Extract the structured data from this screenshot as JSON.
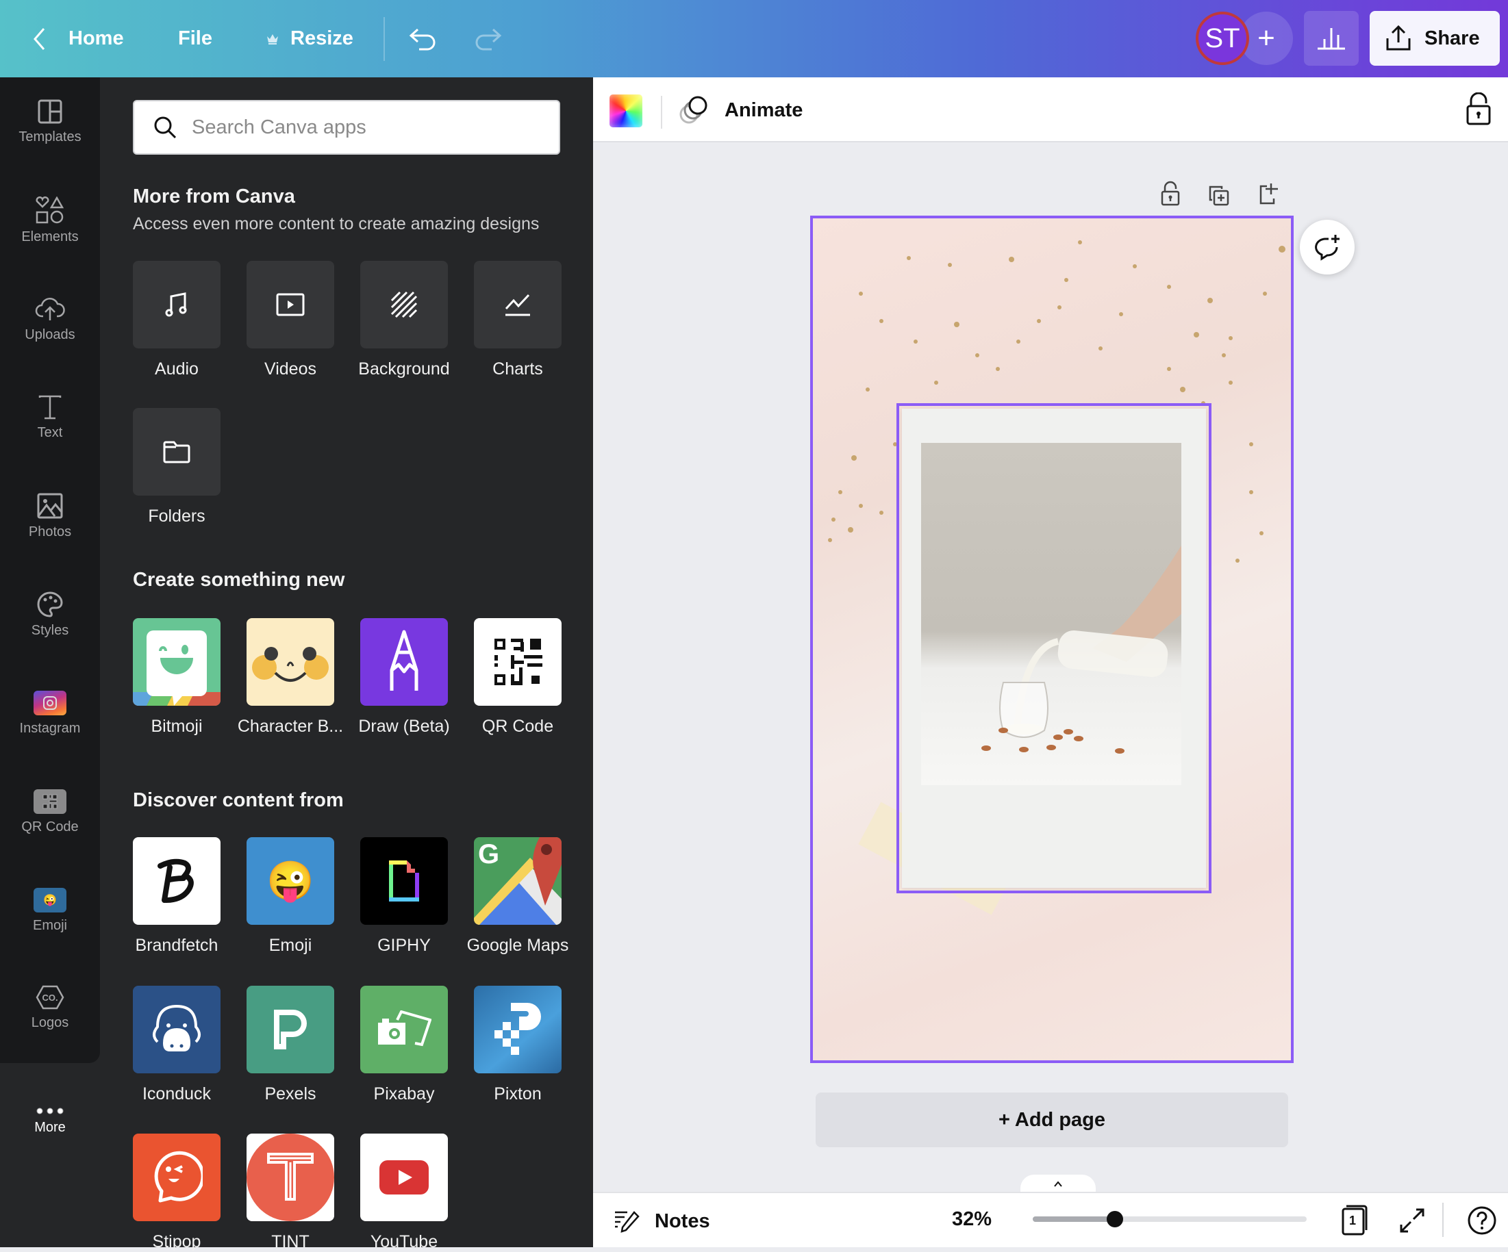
{
  "header": {
    "back_label": "Home",
    "file_label": "File",
    "resize_label": "Resize",
    "avatar_initials": "ST",
    "share_label": "Share",
    "gradient_colors": [
      "#56c1c9",
      "#4f6ad6",
      "#7339d9"
    ]
  },
  "rail": {
    "items": [
      {
        "label": "Templates",
        "icon": "templates-icon"
      },
      {
        "label": "Elements",
        "icon": "elements-icon"
      },
      {
        "label": "Uploads",
        "icon": "upload-cloud-icon"
      },
      {
        "label": "Text",
        "icon": "text-icon"
      },
      {
        "label": "Photos",
        "icon": "photo-icon"
      },
      {
        "label": "Styles",
        "icon": "palette-icon"
      },
      {
        "label": "Instagram",
        "icon": "instagram-icon"
      },
      {
        "label": "QR Code",
        "icon": "qr-code-icon"
      },
      {
        "label": "Emoji",
        "icon": "emoji-icon"
      },
      {
        "label": "Logos",
        "icon": "logos-icon"
      }
    ],
    "more_label": "More"
  },
  "panel": {
    "search_placeholder": "Search Canva apps",
    "more_from_canva": {
      "title": "More from Canva",
      "subtitle": "Access even more content to create amazing designs",
      "items": [
        {
          "label": "Audio",
          "icon": "music-note-icon"
        },
        {
          "label": "Videos",
          "icon": "video-play-icon"
        },
        {
          "label": "Background",
          "icon": "background-stripes-icon"
        },
        {
          "label": "Charts",
          "icon": "line-chart-icon"
        },
        {
          "label": "Folders",
          "icon": "folder-icon"
        }
      ]
    },
    "create_new": {
      "title": "Create something new",
      "items": [
        {
          "label": "Bitmoji",
          "icon": "bitmoji-icon"
        },
        {
          "label": "Character B...",
          "icon": "character-builder-icon"
        },
        {
          "label": "Draw (Beta)",
          "icon": "draw-icon"
        },
        {
          "label": "QR Code",
          "icon": "qr-code-icon"
        }
      ]
    },
    "discover": {
      "title": "Discover content from",
      "items": [
        {
          "label": "Brandfetch",
          "icon": "brandfetch-icon"
        },
        {
          "label": "Emoji",
          "icon": "emoji-icon"
        },
        {
          "label": "GIPHY",
          "icon": "giphy-icon"
        },
        {
          "label": "Google Maps",
          "icon": "google-maps-icon"
        },
        {
          "label": "Iconduck",
          "icon": "iconduck-icon"
        },
        {
          "label": "Pexels",
          "icon": "pexels-icon"
        },
        {
          "label": "Pixabay",
          "icon": "pixabay-icon"
        },
        {
          "label": "Pixton",
          "icon": "pixton-icon"
        },
        {
          "label": "Stipop",
          "icon": "stipop-icon"
        },
        {
          "label": "TINT",
          "icon": "tint-icon"
        },
        {
          "label": "YouTube",
          "icon": "youtube-icon"
        }
      ]
    }
  },
  "toolbar": {
    "animate_label": "Animate"
  },
  "canvas": {
    "add_page_label": "+ Add page",
    "selection_color": "#8b5cf6"
  },
  "footer": {
    "notes_label": "Notes",
    "zoom_label": "32%",
    "zoom_fraction": 0.3,
    "page_count": "1"
  }
}
